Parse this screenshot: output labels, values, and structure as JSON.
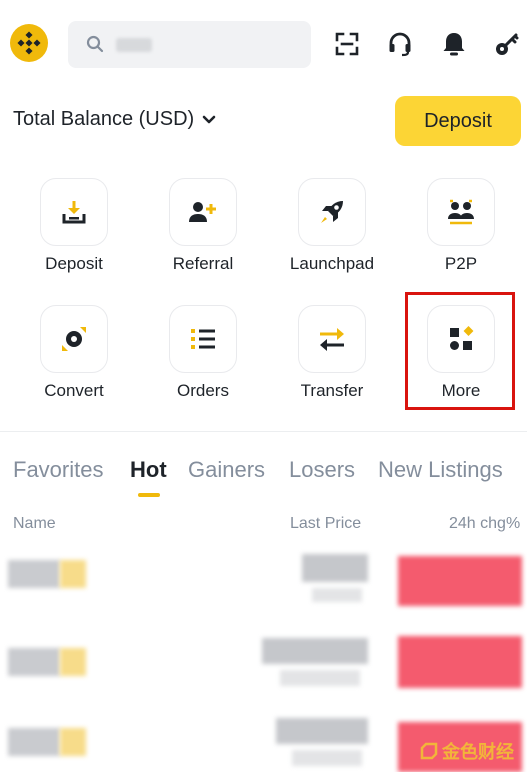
{
  "header": {
    "logo_icon": "binance-logo-icon",
    "search_icon": "search-icon",
    "icons": [
      "scan-icon",
      "headset-icon",
      "bell-icon",
      "key-icon"
    ]
  },
  "balance": {
    "label": "Total Balance (USD)",
    "dropdown_icon": "chevron-down-icon",
    "deposit_button": "Deposit"
  },
  "shortcuts": [
    {
      "label": "Deposit",
      "icon": "deposit-icon"
    },
    {
      "label": "Referral",
      "icon": "add-user-icon"
    },
    {
      "label": "Launchpad",
      "icon": "rocket-icon"
    },
    {
      "label": "P2P",
      "icon": "p2p-icon"
    },
    {
      "label": "Convert",
      "icon": "convert-icon"
    },
    {
      "label": "Orders",
      "icon": "list-icon"
    },
    {
      "label": "Transfer",
      "icon": "transfer-icon"
    },
    {
      "label": "More",
      "icon": "more-icon",
      "highlighted": true
    }
  ],
  "market": {
    "tabs": [
      "Favorites",
      "Hot",
      "Gainers",
      "Losers",
      "New Listings"
    ],
    "active_tab": "Hot",
    "columns": {
      "name": "Name",
      "price": "Last Price",
      "change": "24h chg%"
    }
  },
  "watermark": "金色财经",
  "colors": {
    "brand": "#f0b90b",
    "button": "#fcd535",
    "negative": "#f6465d",
    "highlight_box": "#d9140e"
  }
}
